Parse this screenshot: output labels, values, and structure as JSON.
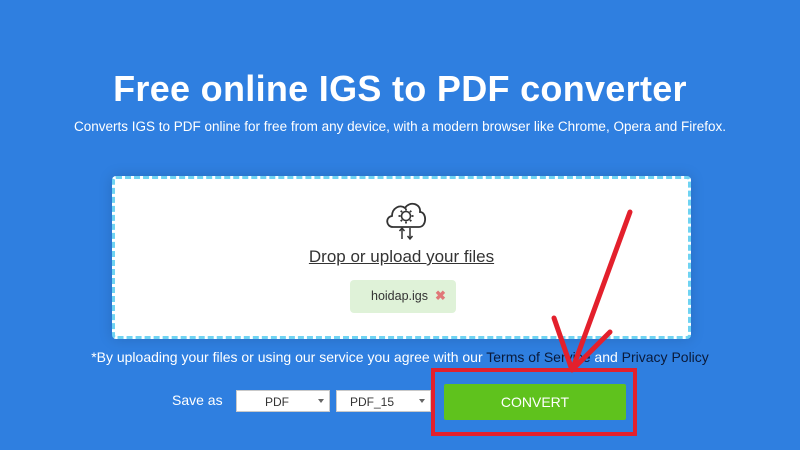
{
  "header": {
    "title": "Free online IGS to PDF converter",
    "subtitle": "Converts IGS to PDF online for free from any device, with a modern browser like Chrome, Opera and Firefox."
  },
  "dropzone": {
    "icon": "cloud-gear-icon",
    "link_text": "Drop or upload your files",
    "file": {
      "name": "hoidap.igs",
      "remove_icon": "close-icon",
      "remove_symbol": "✖"
    }
  },
  "terms": {
    "prefix": "*By uploading your files or using our service you agree with our",
    "terms_link": "Terms of Service",
    "conjunction": "and",
    "privacy_link": "Privacy Policy"
  },
  "save_as": {
    "label": "Save as",
    "format": "PDF",
    "version": "PDF_15"
  },
  "convert_button": {
    "label": "CONVERT"
  },
  "annotation": {
    "arrow_color": "#e3202c",
    "box_color": "#e3202c"
  },
  "colors": {
    "background": "#2f7fe0",
    "accent_green": "#5fc21d"
  }
}
